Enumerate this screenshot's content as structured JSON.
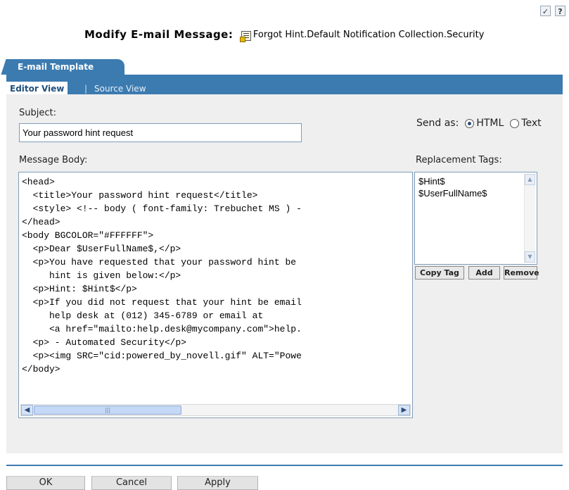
{
  "page_title": "Modify E-mail Message",
  "title_colon": ":",
  "object_name": "Forgot Hint.Default Notification Collection.Security",
  "top_icons": [
    "task-list-icon",
    "help-icon"
  ],
  "help_glyph": "?",
  "tab": {
    "label": "E-mail Template"
  },
  "views": {
    "editor": "Editor View",
    "separator": "|",
    "source": "Source View"
  },
  "subject": {
    "label": "Subject:",
    "value": "Your password hint request"
  },
  "message_body": {
    "label": "Message Body:",
    "lines": [
      "<head>",
      "  <title>Your password hint request</title>",
      "  <style> <!-- body ( font-family: Trebuchet MS ) -",
      "</head>",
      "<body BGCOLOR=\"#FFFFFF\">",
      "  <p>Dear $UserFullName$,</p>",
      "  <p>You have requested that your password hint be",
      "     hint is given below:</p>",
      "  <p>Hint: $Hint$</p>",
      "  <p>If you did not request that your hint be email",
      "     help desk at (012) 345-6789 or email at",
      "     <a href=\"mailto:help.desk@mycompany.com\">help.",
      "  <p> - Automated Security</p>",
      "  <p><img SRC=\"cid:powered_by_novell.gif\" ALT=\"Powe",
      "</body>"
    ]
  },
  "send_as": {
    "label": "Send as:",
    "html": "HTML",
    "text": "Text",
    "selected": "HTML"
  },
  "replacement_tags": {
    "label": "Replacement Tags:",
    "items": [
      "$Hint$",
      "$UserFullName$"
    ]
  },
  "tag_buttons": {
    "copy": "Copy Tag",
    "add": "Add",
    "remove": "Remove"
  },
  "footer": {
    "ok": "OK",
    "cancel": "Cancel",
    "apply": "Apply"
  },
  "colors": {
    "accent": "#3c7bb0",
    "panel": "#efefef"
  }
}
